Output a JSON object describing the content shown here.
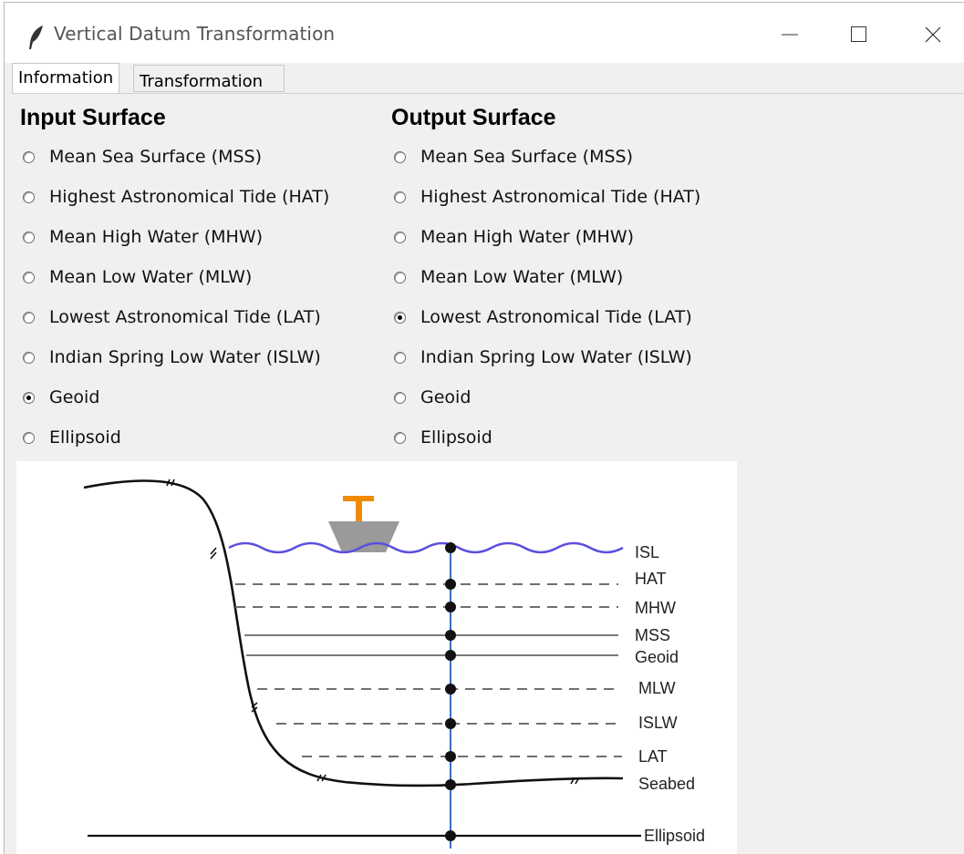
{
  "window": {
    "title": "Vertical Datum Transformation",
    "icon": "feather-icon",
    "controls": [
      "minimize-icon",
      "maximize-icon",
      "close-icon"
    ]
  },
  "tabs": [
    {
      "label": "Information",
      "active": true
    },
    {
      "label": "Transformation",
      "active": false
    }
  ],
  "input_surface": {
    "heading": "Input Surface",
    "selected": "Geoid",
    "options": [
      "Mean Sea Surface (MSS)",
      "Highest Astronomical Tide (HAT)",
      "Mean High Water (MHW)",
      "Mean Low Water (MLW)",
      "Lowest Astronomical Tide (LAT)",
      "Indian Spring Low Water (ISLW)",
      "Geoid",
      "Ellipsoid"
    ]
  },
  "output_surface": {
    "heading": "Output Surface",
    "selected": "Lowest Astronomical Tide (LAT)",
    "options": [
      "Mean Sea Surface (MSS)",
      "Highest Astronomical Tide (HAT)",
      "Mean High Water (MHW)",
      "Mean Low Water (MLW)",
      "Lowest Astronomical Tide (LAT)",
      "Indian Spring Low Water (ISLW)",
      "Geoid",
      "Ellipsoid"
    ]
  },
  "diagram": {
    "labels": [
      "ISL",
      "HAT",
      "MHW",
      "MSS",
      "Geoid",
      "MLW",
      "ISLW",
      "LAT",
      "Seabed",
      "Ellipsoid"
    ],
    "colors": {
      "sea_surface": "#5b4fe0",
      "vertical_axis": "#3a6fc4",
      "buoy_top": "#f08a00",
      "buoy_body": "#9a9a9a",
      "solid_lines": "#7a7a7a",
      "dashed_lines": "#6f6f6f"
    }
  }
}
